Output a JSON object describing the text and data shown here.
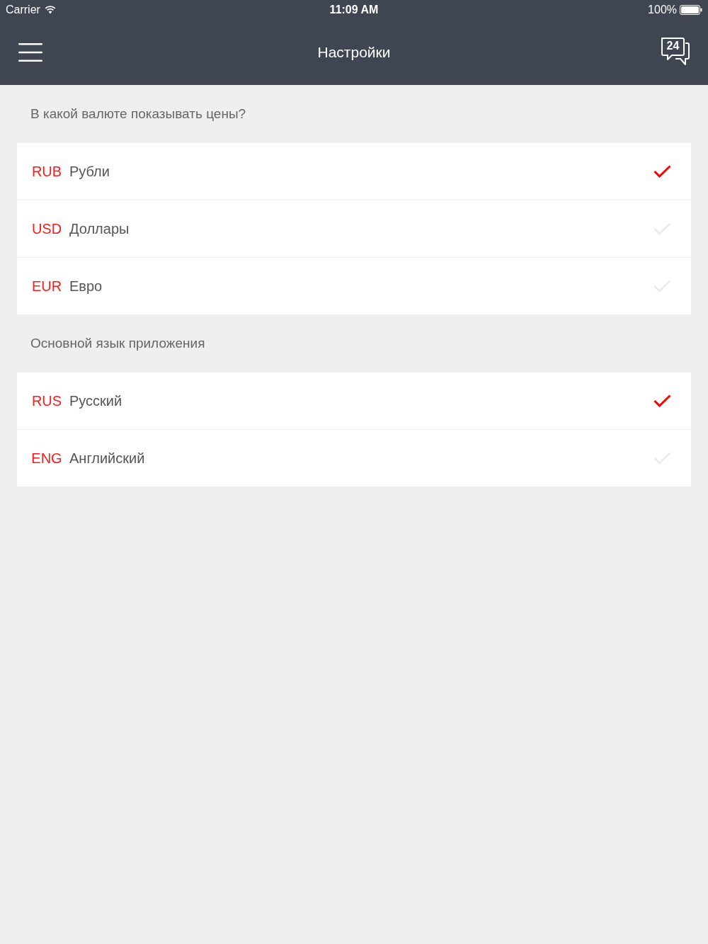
{
  "status_bar": {
    "carrier": "Carrier",
    "time": "11:09 AM",
    "battery": "100%"
  },
  "nav_bar": {
    "title": "Настройки",
    "support_badge": "24"
  },
  "sections": [
    {
      "heading": "В какой валюте показывать цены?",
      "options": [
        {
          "code": "RUB",
          "label": "Рубли",
          "selected": true
        },
        {
          "code": "USD",
          "label": "Доллары",
          "selected": false
        },
        {
          "code": "EUR",
          "label": "Евро",
          "selected": false
        }
      ]
    },
    {
      "heading": "Основной язык приложения",
      "options": [
        {
          "code": "RUS",
          "label": "Русский",
          "selected": true
        },
        {
          "code": "ENG",
          "label": "Английский",
          "selected": false
        }
      ]
    }
  ]
}
